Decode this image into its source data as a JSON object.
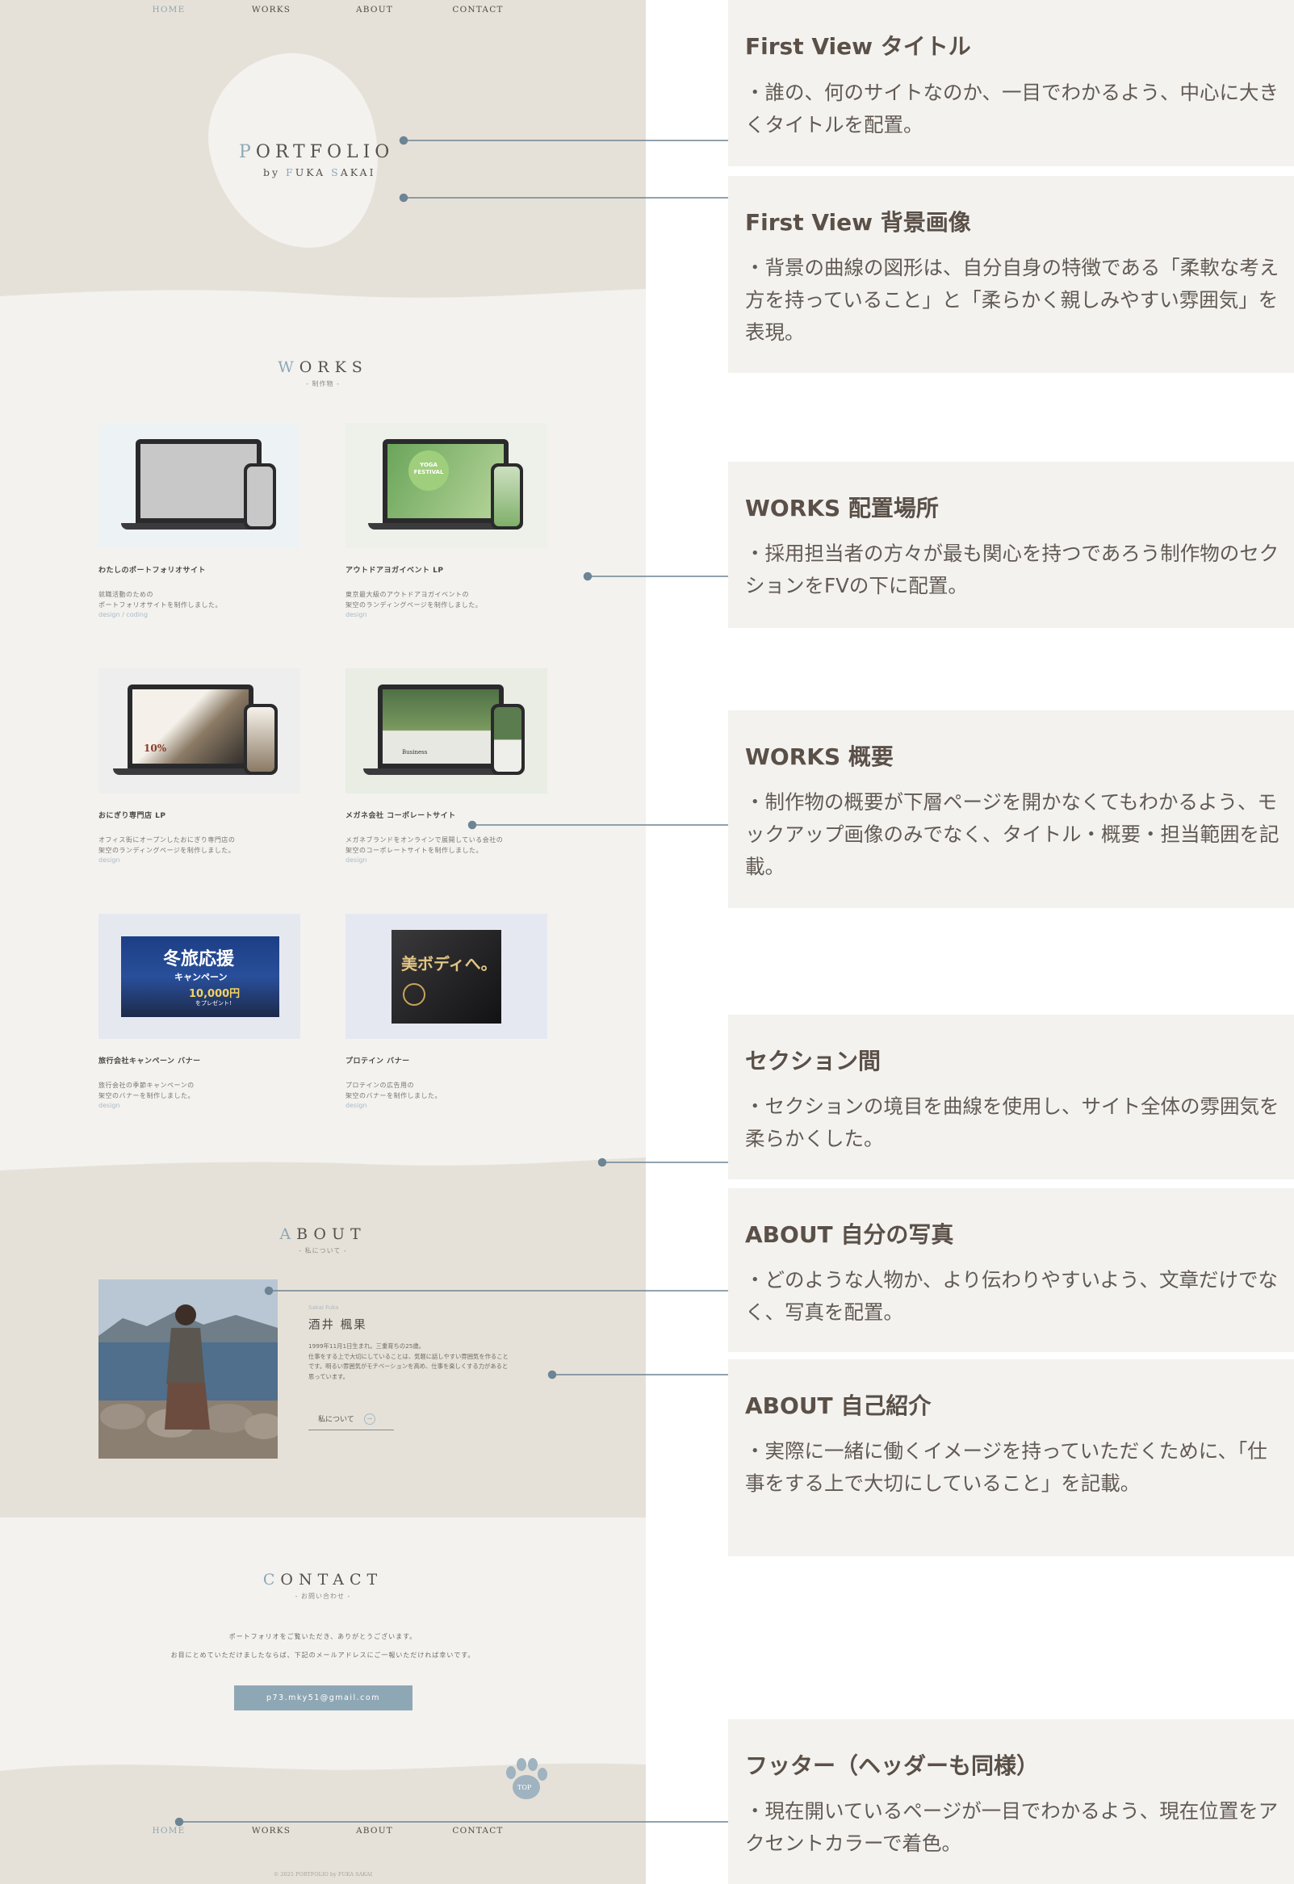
{
  "site": {
    "nav": {
      "items": [
        "HOME",
        "WORKS",
        "ABOUT",
        "CONTACT"
      ],
      "active": "HOME"
    },
    "hero": {
      "title_first": "P",
      "title_rest": "ORTFOLIO",
      "by": "by ",
      "name_f": "F",
      "name_mid": "UKA ",
      "name_s": "S",
      "name_end": "AKAI"
    },
    "works": {
      "title_first": "W",
      "title_rest": "ORKS",
      "subtitle": "-  制作物  -",
      "items": [
        {
          "title": "わたしのポートフォリオサイト",
          "desc": [
            "就職活動のための",
            "ポートフォリオサイトを制作しました。"
          ],
          "tag": "design / coding"
        },
        {
          "title": "アウトドアヨガイベント LP",
          "desc": [
            "東京最大級のアウトドアヨガイベントの",
            "架空のランディングページを制作しました。"
          ],
          "tag": "design"
        },
        {
          "title": "おにぎり専門店 LP",
          "desc": [
            "オフィス街にオープンしたおにぎり専門店の",
            "架空のランディングページを制作しました。"
          ],
          "tag": "design"
        },
        {
          "title": "メガネ会社 コーポレートサイト",
          "desc": [
            "メガネブランドをオンラインで展開している会社の",
            "架空のコーポレートサイトを制作しました。"
          ],
          "tag": "design"
        },
        {
          "title": "旅行会社キャンペーン バナー",
          "desc": [
            "旅行会社の季節キャンペーンの",
            "架空のバナーを制作しました。"
          ],
          "tag": "design"
        },
        {
          "title": "プロテイン バナー",
          "desc": [
            "プロテインの広告用の",
            "架空のバナーを制作しました。"
          ],
          "tag": "design"
        }
      ],
      "mock_texts": {
        "yoga": "YOGA FESTIVAL",
        "onigiri_price": "10%",
        "megane": "Business",
        "travel_main": "冬旅応援",
        "travel_sub": "キャンペーン",
        "travel_amount": "10,000円",
        "travel_note": "をプレゼント!",
        "protein": "美ボディへ。"
      }
    },
    "about": {
      "title_first": "A",
      "title_rest": "BOUT",
      "subtitle": "-  私について  -",
      "name_en": "Sakai Fuka",
      "name": "酒井 楓果",
      "text": [
        "1999年11月1日生まれ。三重育ちの25歳。",
        "仕事をする上で大切にしていることは、気軽に話しやすい雰囲気を作ること",
        "です。明るい雰囲気がモチベーションを高め、仕事を楽しくする力があると",
        "思っています。"
      ],
      "button": "私について",
      "button_arrow": "→"
    },
    "contact": {
      "title_first": "C",
      "title_rest": "ONTACT",
      "subtitle": "-  お問い合わせ  -",
      "line1": "ポートフォリオをご覧いただき、ありがとうございます。",
      "line2": "お目にとめていただけましたならば、下記のメールアドレスにご一報いただければ幸いです。",
      "email": "p73.mky51@gmail.com"
    },
    "footer": {
      "paw_label": "TOP",
      "copyright": "© 2025 PORTFOLIO by FUKA SAKAI"
    }
  },
  "annotations": [
    {
      "title": "First View タイトル",
      "body": "・誰の、何のサイトなのか、一目でわかるよう、中心に大きくタイトルを配置。"
    },
    {
      "title": "First View 背景画像",
      "body": "・背景の曲線の図形は、自分自身の特徴である「柔軟な考え方を持っていること」と「柔らかく親しみやすい雰囲気」を表現。"
    },
    {
      "title": "WORKS 配置場所",
      "body": "・採用担当者の方々が最も関心を持つであろう制作物のセクションをFVの下に配置。"
    },
    {
      "title": "WORKS 概要",
      "body": "・制作物の概要が下層ページを開かなくてもわかるよう、モックアップ画像のみでなく、タイトル・概要・担当範囲を記載。"
    },
    {
      "title": "セクション間",
      "body": "・セクションの境目を曲線を使用し、サイト全体の雰囲気を柔らかくした。"
    },
    {
      "title": "ABOUT 自分の写真",
      "body": "・どのような人物か、より伝わりやすいよう、文章だけでなく、写真を配置。"
    },
    {
      "title": "ABOUT 自己紹介",
      "body": "・実際に一緒に働くイメージを持っていただくために、「仕事をする上で大切にしていること」を記載。"
    },
    {
      "title": "フッター（ヘッダーも同様）",
      "body": "・現在開いているページが一目でわかるよう、現在位置をアクセントカラーで着色。"
    }
  ],
  "colors": {
    "accent": "#8ea7b5",
    "beige": "#e6e1d8",
    "light": "#f3f2ef",
    "line": "#6d8494"
  }
}
